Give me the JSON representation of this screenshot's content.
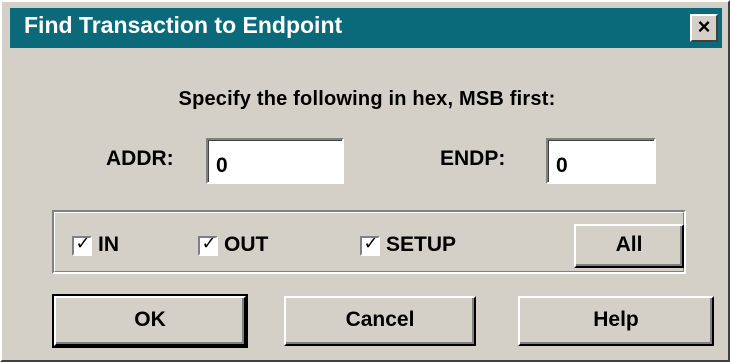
{
  "window": {
    "title": "Find Transaction to Endpoint",
    "close_label": "×"
  },
  "instructions": "Specify the following in hex, MSB first:",
  "fields": {
    "addr": {
      "label": "ADDR:",
      "value": "0"
    },
    "endp": {
      "label": "ENDP:",
      "value": "0"
    }
  },
  "filters": {
    "in": {
      "label": "IN",
      "checked": true
    },
    "out": {
      "label": "OUT",
      "checked": true
    },
    "setup": {
      "label": "SETUP",
      "checked": true
    },
    "all_label": "All"
  },
  "buttons": {
    "ok": "OK",
    "cancel": "Cancel",
    "help": "Help"
  },
  "colors": {
    "titlebar": "#0b6a7a",
    "dialog_bg": "#d4d0c8"
  }
}
